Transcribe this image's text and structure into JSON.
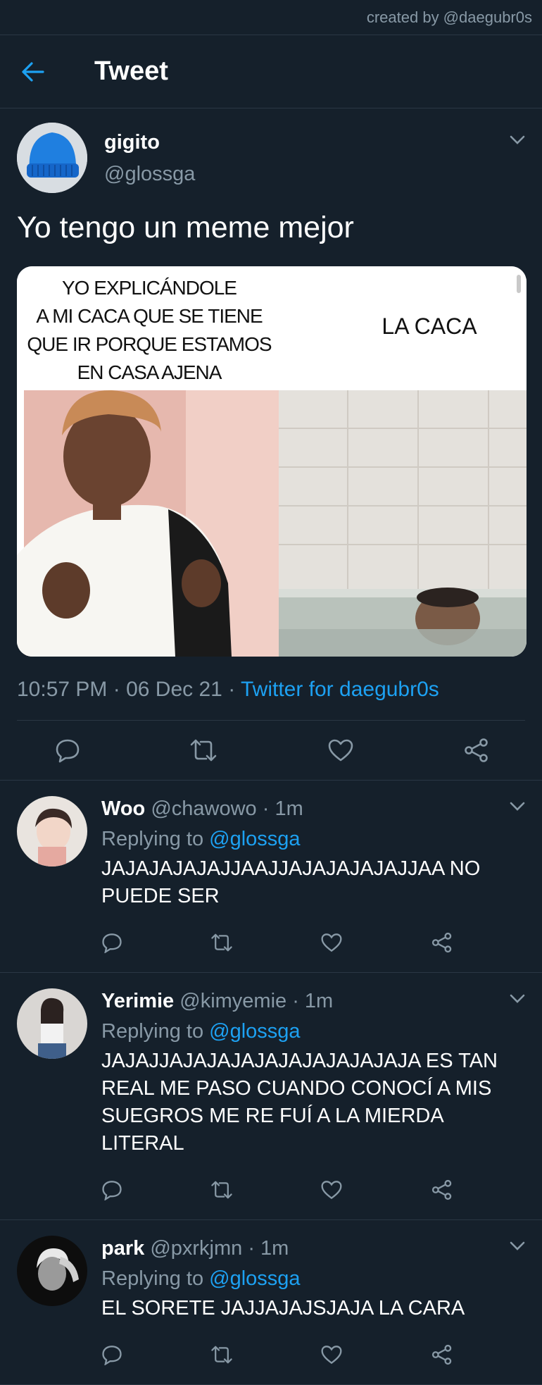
{
  "watermark": "created by @daegubr0s",
  "header": {
    "title": "Tweet"
  },
  "tweet": {
    "name": "gigito",
    "handle": "@glossga",
    "text": "Yo tengo un meme mejor",
    "meme": {
      "left_caption": [
        "YO EXPLICÁNDOLE",
        "A MI CACA QUE SE TIENE",
        "QUE IR PORQUE ESTAMOS",
        "EN CASA AJENA"
      ],
      "right_caption": "LA CACA"
    },
    "time": "10:57 PM",
    "date": "06 Dec 21",
    "sep": " · ",
    "source": "Twitter for daegubr0s"
  },
  "replies": [
    {
      "name": "Woo",
      "handle": "@chawowo",
      "time": " · 1m",
      "replying_label": "Replying to ",
      "mention": "@glossga",
      "text": "JAJAJAJAJAJJAAJJAJAJAJAJAJJAA NO PUEDE SER"
    },
    {
      "name": "Yerimie",
      "handle": "@kimyemie",
      "time": " · 1m",
      "replying_label": "Replying to ",
      "mention": "@glossga",
      "text": "JAJAJJAJAJAJAJAJAJAJAJAJAJA ES TAN REAL ME PASO CUANDO CONOCÍ A MIS SUEGROS ME RE FUÍ A LA MIERDA LITERAL"
    },
    {
      "name": "park",
      "handle": "@pxrkjmn",
      "time": " · 1m",
      "replying_label": "Replying to ",
      "mention": "@glossga",
      "text": "EL SORETE JAJJAJAJSJAJA LA CARA"
    }
  ],
  "colors": {
    "background": "#15202b",
    "accent": "#1da1f2",
    "muted": "#8899a6",
    "divider": "#2a3744"
  },
  "icons": [
    "back-arrow-icon",
    "chevron-down-icon",
    "reply-icon",
    "retweet-icon",
    "like-icon",
    "share-icon"
  ]
}
